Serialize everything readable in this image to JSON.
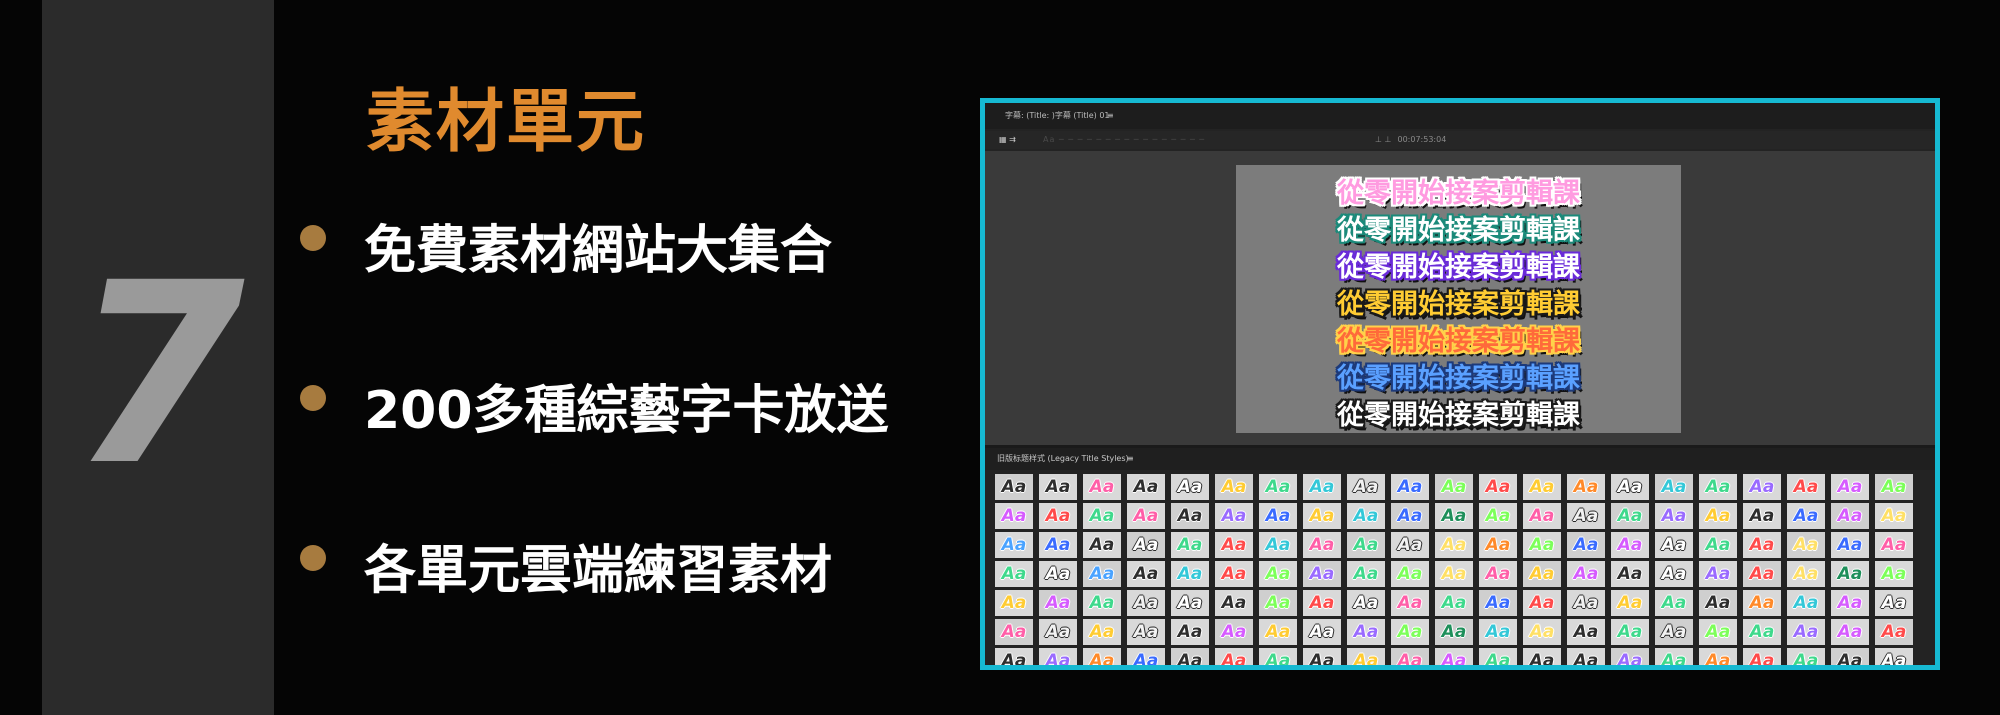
{
  "slide": {
    "number": "7",
    "title": "素材單元",
    "bullets": [
      "免費素材網站大集合",
      "200多種綜藝字卡放送",
      "各單元雲端練習素材"
    ]
  },
  "editor": {
    "tab_title": "字幕: (Title: )字幕 (Title) 01",
    "tab_menu_icon": "≡",
    "toolbar_icons": "▦ ⇉",
    "toolbar_greyed": "Aa  ─  ─  ─  ─  ─  ─  ─  ─  ─  ─  ─  ─  ─  ─  ─  ─",
    "toolbar_right": "⊥ ⊥",
    "timecode": "00:07:53:04",
    "sample_text": "從零開始接案剪輯課",
    "samples": [
      {
        "color": "#ff9be0",
        "stroke": "#ffffff"
      },
      {
        "color": "#ffffff",
        "stroke": "#1b8a7a"
      },
      {
        "color": "#ffffff",
        "stroke": "#6a2bd9"
      },
      {
        "color": "#ffcc33",
        "stroke": "#1a1a1a"
      },
      {
        "color": "#ff6a3a",
        "stroke": "#ffd24a"
      },
      {
        "color": "#5aa0ff",
        "stroke": "#1d3a7a"
      },
      {
        "color": "#ffffff",
        "stroke": "#1a1a1a"
      }
    ],
    "styles_panel_title": "旧版标题样式 (Legacy Title Styles)",
    "styles_menu_icon": "≡",
    "swatch_label": "Aa",
    "swatch_palette": [
      "#2e2e2e",
      "#ffffff",
      "#ff5fa8",
      "#3fd98c",
      "#9a6bff",
      "#ffcc33",
      "#ff4b4b",
      "#34c8d8",
      "#ff8a2a",
      "#3a6bff",
      "#7dff5a",
      "#d65cff",
      "#f2f2f2",
      "#1e8f5a",
      "#ffe066",
      "#4aa3ff"
    ],
    "swatch_pattern": [
      [
        0,
        0,
        2,
        0,
        1,
        5,
        3,
        7,
        12,
        9,
        10,
        6,
        5,
        8,
        1,
        7,
        3,
        4,
        6,
        11,
        10
      ],
      [
        11,
        6,
        3,
        2,
        0,
        4,
        9,
        5,
        7,
        9,
        13,
        10,
        2,
        12,
        3,
        4,
        5,
        0,
        9,
        11,
        14
      ],
      [
        15,
        9,
        0,
        1,
        3,
        6,
        7,
        2,
        3,
        12,
        14,
        8,
        10,
        9,
        11,
        1,
        3,
        6,
        14,
        9,
        2
      ],
      [
        3,
        1,
        15,
        0,
        7,
        6,
        10,
        4,
        3,
        10,
        14,
        2,
        5,
        11,
        0,
        1,
        4,
        6,
        14,
        13,
        10
      ],
      [
        5,
        11,
        3,
        12,
        1,
        0,
        10,
        6,
        1,
        2,
        3,
        9,
        6,
        12,
        5,
        3,
        0,
        8,
        7,
        11,
        1
      ],
      [
        2,
        12,
        5,
        12,
        0,
        11,
        5,
        1,
        4,
        10,
        13,
        7,
        14,
        0,
        3,
        12,
        10,
        3,
        4,
        11,
        6
      ],
      [
        0,
        4,
        8,
        9,
        0,
        6,
        3,
        0,
        5,
        2,
        11,
        3,
        0,
        0,
        4,
        3,
        8,
        6,
        3,
        0,
        1
      ]
    ]
  },
  "colors": {
    "accent": "#e08a2e",
    "frame": "#16b9d2",
    "bullet": "#a77b3f",
    "number": "#9a9a9a"
  }
}
